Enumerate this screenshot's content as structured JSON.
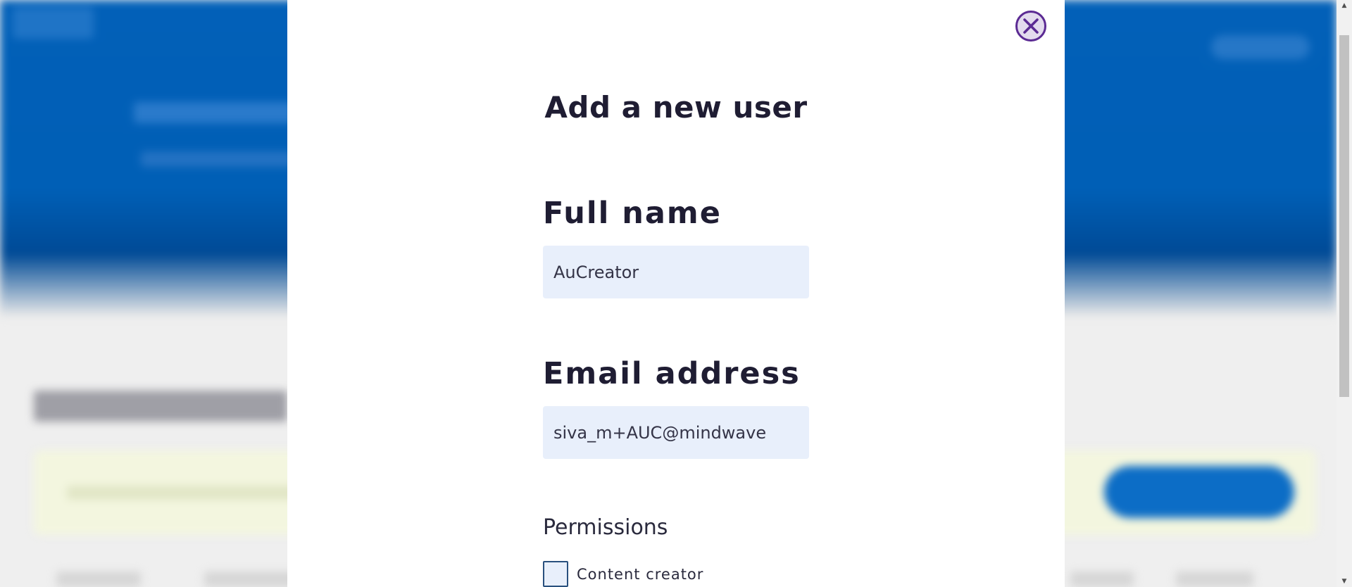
{
  "modal": {
    "title": "Add a new user",
    "full_name": {
      "label": "Full name",
      "value": "AuCreator"
    },
    "email": {
      "label": "Email address",
      "value": "siva_m+AUC@mindwave"
    },
    "permissions": {
      "heading": "Permissions",
      "options": [
        {
          "label": "Content creator",
          "checked": false
        }
      ]
    }
  },
  "icons": {
    "close": "close-icon",
    "scroll_up": "scroll-up-arrow-icon",
    "scroll_down": "scroll-down-arrow-icon"
  },
  "colors": {
    "backdrop_blue": "#005fb6",
    "modal_bg": "#ffffff",
    "input_bg": "#e8effb",
    "close_accent": "#5b2a93",
    "heading_text": "#1f1d33"
  }
}
